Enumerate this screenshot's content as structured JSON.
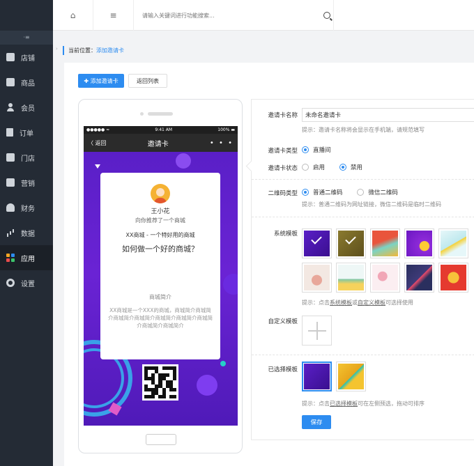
{
  "sidebar": {
    "collapse_glyph": "⋅≡",
    "items": [
      {
        "label": "店铺",
        "icon": "store-icon"
      },
      {
        "label": "商品",
        "icon": "goods-icon"
      },
      {
        "label": "会员",
        "icon": "user-icon"
      },
      {
        "label": "订单",
        "icon": "order-icon"
      },
      {
        "label": "门店",
        "icon": "shop-icon"
      },
      {
        "label": "营销",
        "icon": "marketing-icon"
      },
      {
        "label": "财务",
        "icon": "finance-icon"
      },
      {
        "label": "数据",
        "icon": "chart-icon"
      },
      {
        "label": "应用",
        "icon": "apps-icon",
        "active": true
      },
      {
        "label": "设置",
        "icon": "gear-icon"
      }
    ]
  },
  "topbar": {
    "home_glyph": "⌂",
    "menu_glyph": "≡",
    "search_placeholder": "请输入关键词进行功能搜索..."
  },
  "breadcrumb": {
    "prefix": "当前位置：",
    "current": "添加邀请卡"
  },
  "toolbar": {
    "add_label": "✚ 添加邀请卡",
    "back_label": "返回列表"
  },
  "phone": {
    "status_left": "●●●●● ≈",
    "status_time": "9:41 AM",
    "status_right": "100% ▬",
    "back_label": "〈 返回",
    "title": "邀请卡",
    "more_glyph": "• • •",
    "card": {
      "name": "王小花",
      "recommend": "向你推荐了一个商城",
      "slogan": "XX商城 - 一个特好用的商城",
      "headline": "如何做一个好的商城？",
      "intro_title": "商城简介",
      "intro_text": "XX商城是一个XXX的商城，商城简介商城简介商城简介商城简介商城简介商城简介商城简介商城简介商城简介"
    }
  },
  "form": {
    "name_label": "邀请卡名称",
    "name_value": "未命名邀请卡",
    "name_hint": "提示：邀请卡名称将会显示在手机端，请规范填写",
    "type_label": "邀请卡类型",
    "type_options": [
      {
        "label": "直播间",
        "checked": true
      }
    ],
    "status_label": "邀请卡状态",
    "status_options": [
      {
        "label": "启用",
        "checked": false
      },
      {
        "label": "禁用",
        "checked": true
      }
    ],
    "qr_label": "二维码类型",
    "qr_options": [
      {
        "label": "普通二维码",
        "checked": true
      },
      {
        "label": "微信二维码",
        "checked": false
      }
    ],
    "qr_hint": "提示：普通二维码为网址链接，微信二维码是临时二维码",
    "system_label": "系统模板",
    "system_hint_pre": "提示：点击",
    "system_hint_link1": "系统模板",
    "system_hint_mid": "或",
    "system_hint_link2": "自定义模板",
    "system_hint_post": "可选择使用",
    "custom_label": "自定义模板",
    "selected_label": "已选择模板",
    "selected_hint_pre": "提示：点击",
    "selected_hint_link": "已选择模板",
    "selected_hint_post": "可在左侧预选，拖动可排序",
    "save_label": "保存"
  },
  "colors": {
    "accent": "#2d8cf0",
    "sidebar_bg": "#242b35",
    "poster_purple": "#5a1fc7"
  }
}
